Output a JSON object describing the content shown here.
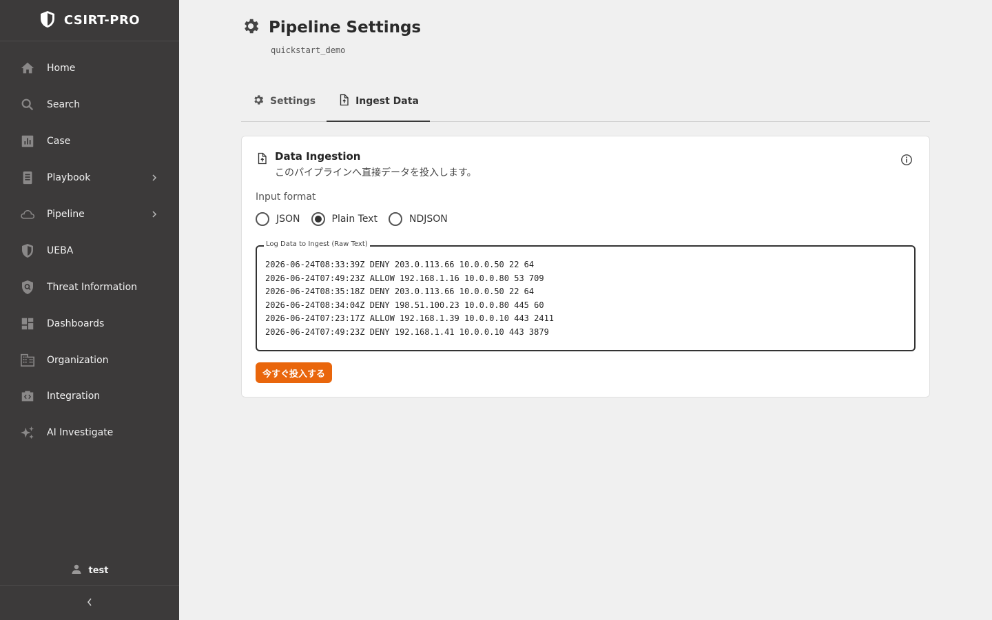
{
  "app": {
    "brand": "CSIRT-PRO"
  },
  "sidebar": {
    "items": [
      {
        "label": "Home",
        "icon": "home-icon"
      },
      {
        "label": "Search",
        "icon": "search-icon"
      },
      {
        "label": "Case",
        "icon": "bar-chart-icon"
      },
      {
        "label": "Playbook",
        "icon": "book-icon",
        "expandable": true
      },
      {
        "label": "Pipeline",
        "icon": "cloud-icon",
        "expandable": true
      },
      {
        "label": "UEBA",
        "icon": "shield-icon"
      },
      {
        "label": "Threat Information",
        "icon": "shield-search-icon"
      },
      {
        "label": "Dashboards",
        "icon": "dashboard-icon"
      },
      {
        "label": "Organization",
        "icon": "building-icon"
      },
      {
        "label": "Integration",
        "icon": "integration-icon"
      },
      {
        "label": "AI Investigate",
        "icon": "sparkle-icon"
      }
    ],
    "user": "test"
  },
  "header": {
    "title": "Pipeline Settings",
    "subtitle": "quickstart_demo"
  },
  "tabs": [
    {
      "label": "Settings",
      "active": false
    },
    {
      "label": "Ingest Data",
      "active": true
    }
  ],
  "ingest": {
    "title": "Data Ingestion",
    "description": "このパイプラインへ直接データを投入します。",
    "format_label": "Input format",
    "formats": [
      {
        "label": "JSON",
        "checked": false
      },
      {
        "label": "Plain Text",
        "checked": true
      },
      {
        "label": "NDJSON",
        "checked": false
      }
    ],
    "field_label": "Log Data to Ingest (Raw Text)",
    "log_lines": [
      "2026-06-24T08:33:39Z DENY 203.0.113.66 10.0.0.50 22 64",
      "2026-06-24T07:49:23Z ALLOW 192.168.1.16 10.0.0.80 53 709",
      "2026-06-24T08:35:18Z DENY 203.0.113.66 10.0.0.50 22 64",
      "2026-06-24T08:34:04Z DENY 198.51.100.23 10.0.0.80 445 60",
      "2026-06-24T07:23:17Z ALLOW 192.168.1.39 10.0.0.10 443 2411",
      "2026-06-24T07:49:23Z DENY 192.168.1.41 10.0.0.10 443 3879"
    ],
    "submit_label": "今すぐ投入する"
  },
  "colors": {
    "sidebar_bg": "#3c3a3a",
    "accent": "#e9660c",
    "page_bg": "#f0f0f0"
  }
}
